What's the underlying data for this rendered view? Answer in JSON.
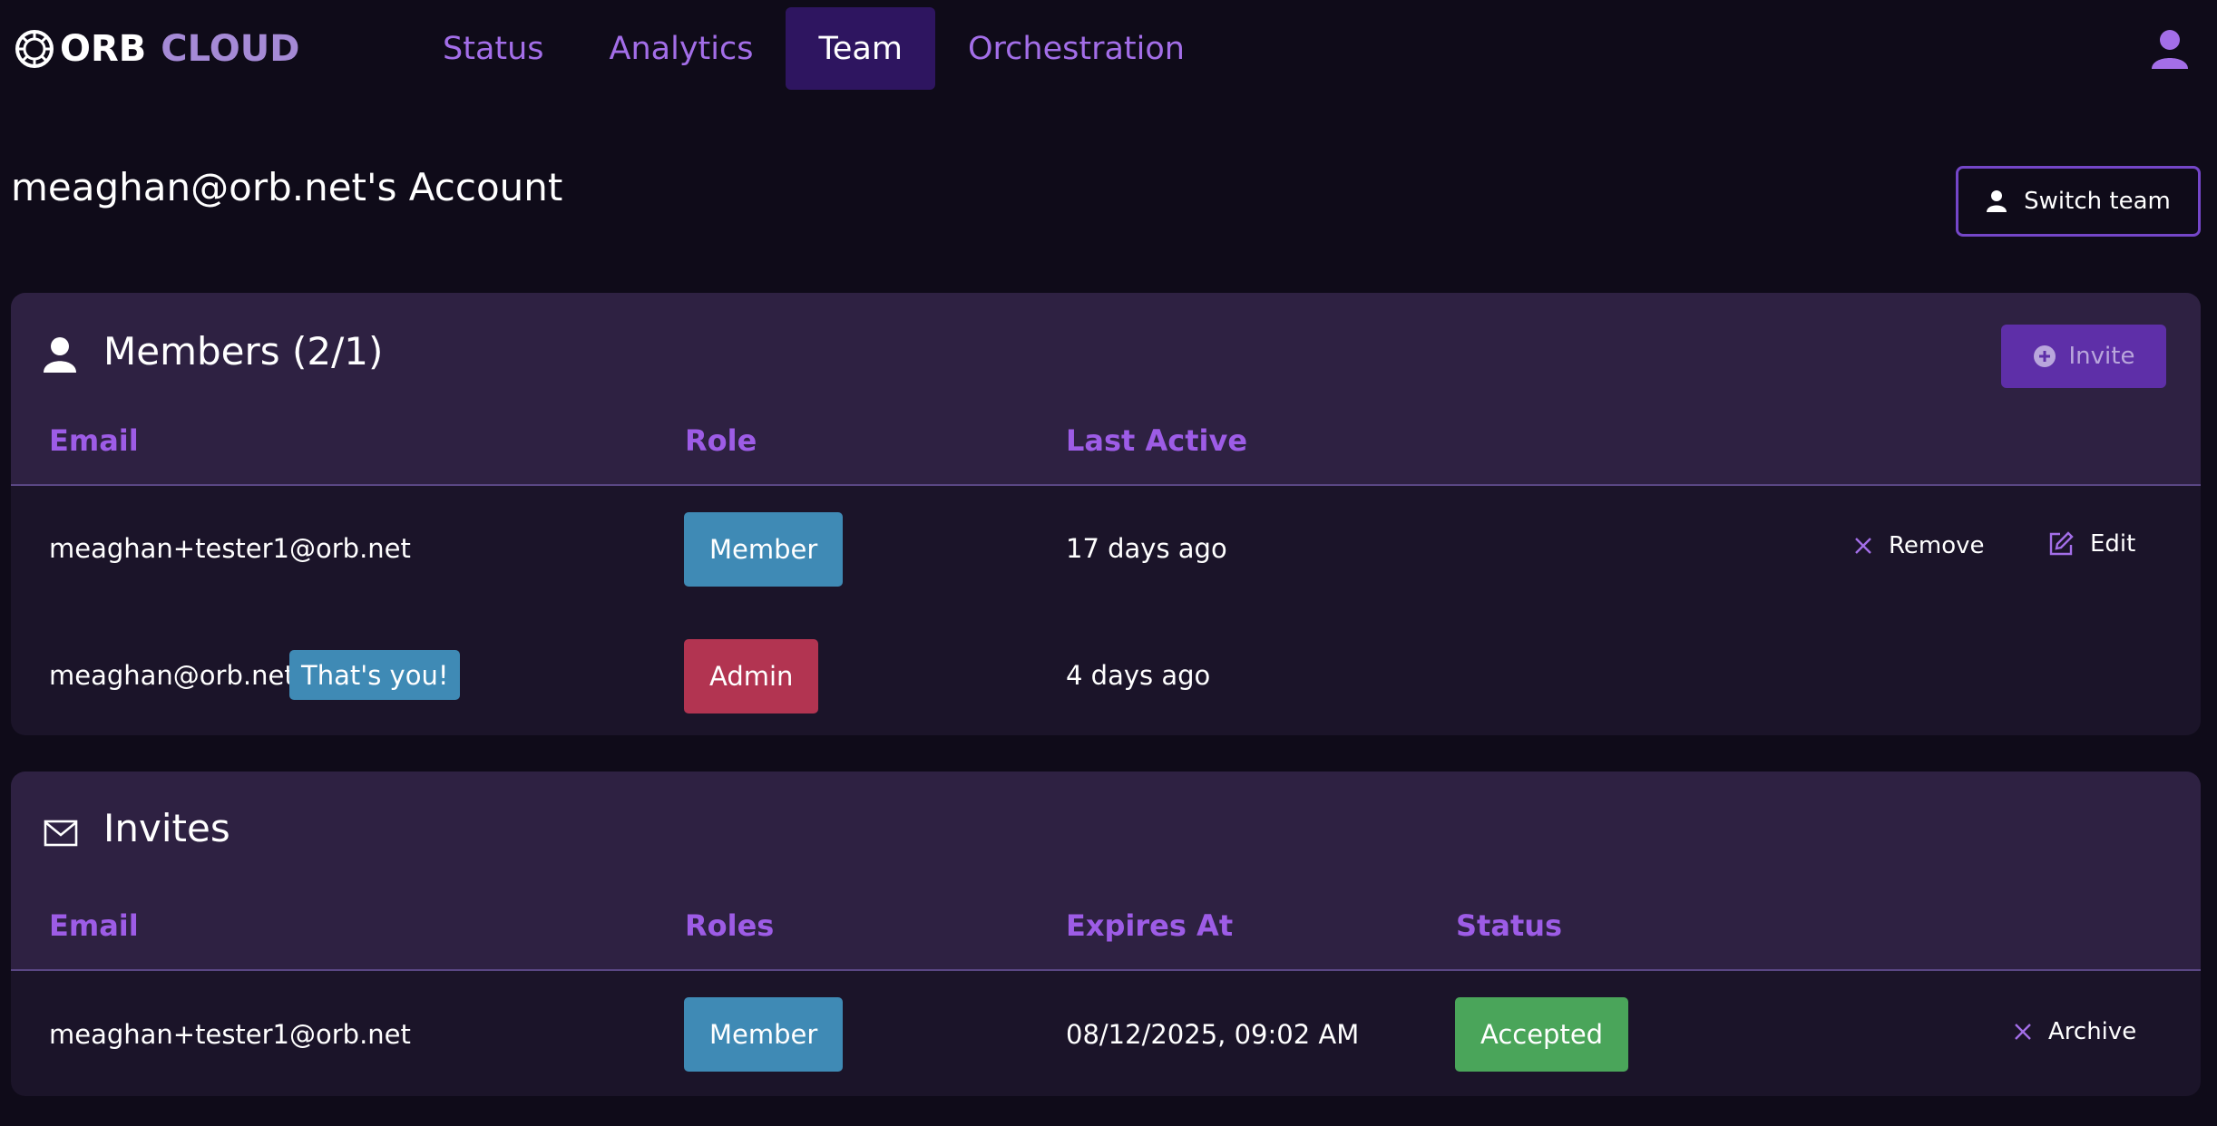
{
  "brand": {
    "name_bold": "ORB",
    "name_light": "CLOUD"
  },
  "nav": {
    "items": [
      {
        "label": "Status"
      },
      {
        "label": "Analytics"
      },
      {
        "label": "Team"
      },
      {
        "label": "Orchestration"
      }
    ],
    "active": "Team"
  },
  "account": {
    "title": "meaghan@orb.net's Account",
    "switch_team_label": "Switch team"
  },
  "members": {
    "title": "Members (2/1)",
    "invite_label": "Invite",
    "columns": {
      "email": "Email",
      "role": "Role",
      "last_active": "Last Active"
    },
    "rows": [
      {
        "email": "meaghan+tester1@orb.net",
        "role": "Member",
        "last_active": "17 days ago",
        "remove_label": "Remove",
        "edit_label": "Edit"
      },
      {
        "email": "meaghan@orb.net",
        "you_badge": "That's you!",
        "role": "Admin",
        "last_active": "4 days ago"
      }
    ]
  },
  "invites": {
    "title": "Invites",
    "columns": {
      "email": "Email",
      "roles": "Roles",
      "expires_at": "Expires At",
      "status": "Status"
    },
    "rows": [
      {
        "email": "meaghan+tester1@orb.net",
        "role": "Member",
        "expires_at": "08/12/2025, 09:02 AM",
        "status": "Accepted",
        "archive_label": "Archive"
      }
    ]
  },
  "colors": {
    "background": "#0f0b19",
    "card": "#1b1429",
    "card_header": "#2e2142",
    "accent": "#9d5ce6",
    "nav_active": "#2e1560",
    "member_badge": "#3f8ab5",
    "admin_badge": "#b23451",
    "accepted_badge": "#4aa55a"
  },
  "icons": [
    "orb-logo-icon",
    "user-avatar-icon",
    "user-icon",
    "plus-circle-icon",
    "close-icon",
    "edit-icon",
    "mail-icon"
  ]
}
